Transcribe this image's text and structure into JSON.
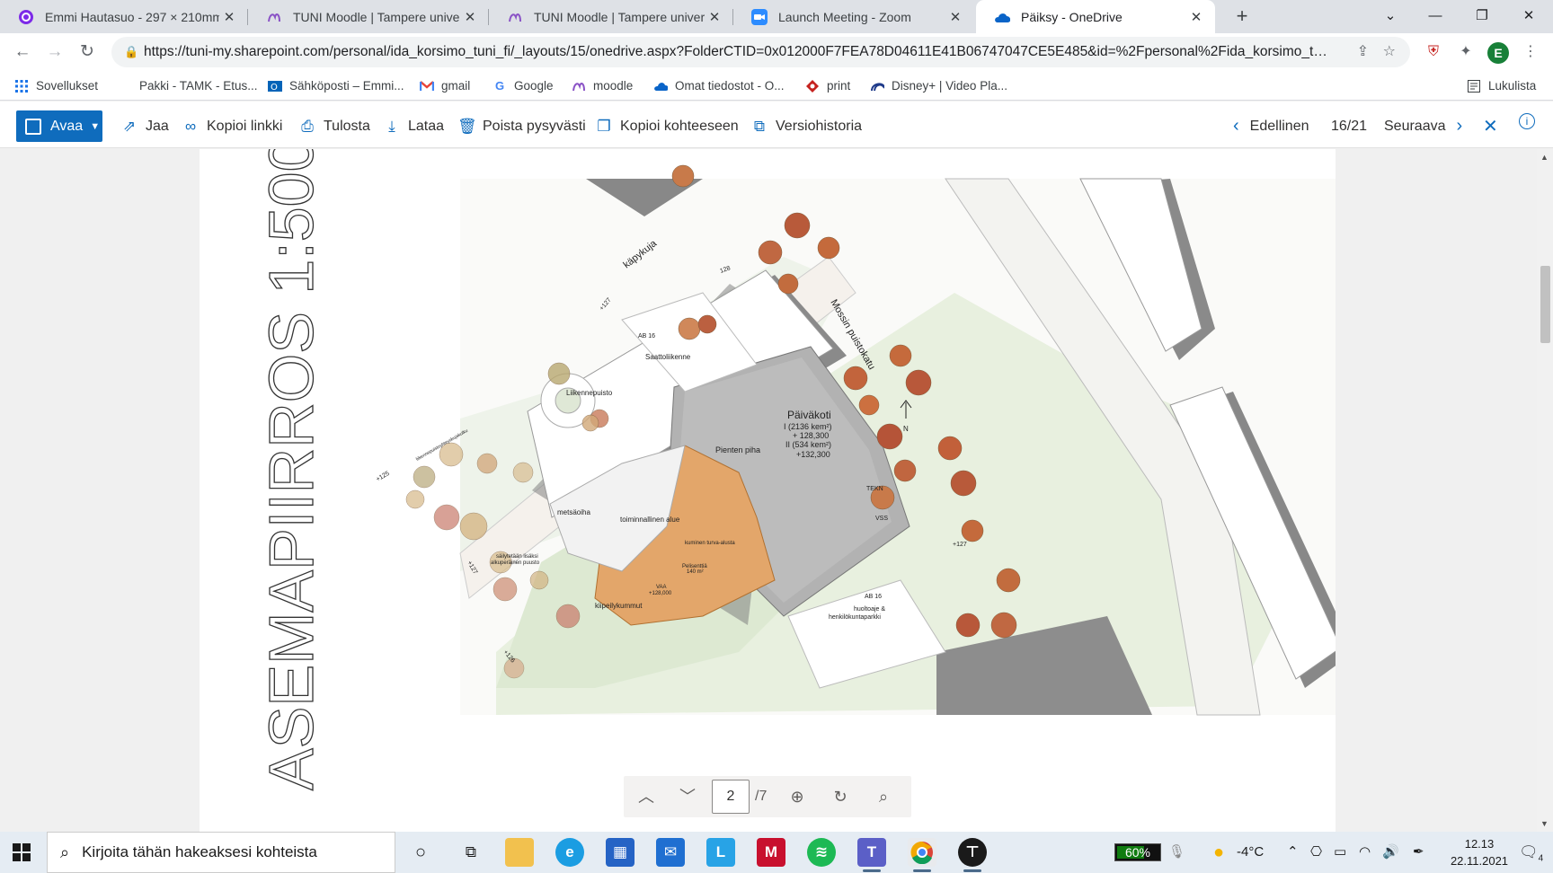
{
  "browser": {
    "tabs": [
      {
        "title": "Emmi Hautasuo - 297 × 210mm",
        "icon": "canva-icon"
      },
      {
        "title": "TUNI Moodle | Tampere universit",
        "icon": "moodle-icon"
      },
      {
        "title": "TUNI Moodle | Tampere universit",
        "icon": "moodle-icon"
      },
      {
        "title": "Launch Meeting - Zoom",
        "icon": "zoom-icon"
      },
      {
        "title": "Päiksy - OneDrive",
        "icon": "onedrive-icon"
      }
    ],
    "url": "https://tuni-my.sharepoint.com/personal/ida_korsimo_tuni_fi/_layouts/15/onedrive.aspx?FolderCTID=0x012000F7FEA78D04611E41B06747047CE5E485&id=%2Fpersonal%2Fida_korsimo_tuni_...",
    "profile_initial": "E",
    "bookmarks": [
      {
        "label": "Sovellukset",
        "icon": "apps-grid-icon"
      },
      {
        "label": "Pakki - TAMK - Etus...",
        "icon": "none"
      },
      {
        "label": "Sähköposti – Emmi...",
        "icon": "outlook-icon"
      },
      {
        "label": "gmail",
        "icon": "gmail-icon"
      },
      {
        "label": "Google",
        "icon": "google-icon"
      },
      {
        "label": "moodle",
        "icon": "moodle-icon"
      },
      {
        "label": "Omat tiedostot - O...",
        "icon": "onedrive-icon"
      },
      {
        "label": "print",
        "icon": "print-icon"
      },
      {
        "label": "Disney+ | Video Pla...",
        "icon": "disney-icon"
      }
    ],
    "reading_list": "Lukulista"
  },
  "commandbar": {
    "open": "Avaa",
    "share": "Jaa",
    "copy_link": "Kopioi linkki",
    "print": "Tulosta",
    "download": "Lataa",
    "delete": "Poista pysyvästi",
    "copy_to": "Kopioi kohteeseen",
    "version_history": "Versiohistoria",
    "previous": "Edellinen",
    "position": "16/21",
    "next": "Seuraava"
  },
  "document": {
    "title": "ASEMAPIIRROS 1:500",
    "plan_labels": {
      "kapykuja": "käpykuja",
      "mossin": "Mossin puistokatu",
      "ab16_top": "AB 16",
      "saatto": "Saattoliikenne",
      "liikennepuisto": "Liikennepuisto",
      "paivakoti": "Päiväkoti",
      "area1": "I (2136 kem²)",
      "h1": "+ 128,300",
      "area2": "II (534 kem²)",
      "h2": "+132,300",
      "pienten": "Pienten piha",
      "metsaoiha": "metsäoiha",
      "toiminnallinen": "toiminnallinen alue",
      "kuminen": "kuminen turva-alusta",
      "pelisenttia": "Pelisenttiä",
      "pelisenttia_area": "140 m²",
      "kiipeily": "kiipeilykummut",
      "vaa": "VAA",
      "vaa_h": "+128,000",
      "sailytetaan": "säilytetään lisäksi",
      "alkuperainen": "alkuperäinen puusto",
      "tekn": "TEKN",
      "vss": "VSS",
      "ab16_bottom": "AB 16",
      "huolto": "huoltoaje &",
      "henkilokunta": "henkilökuntaparkki",
      "path": "liikennepuistoyhteyskujakulku",
      "e125": "+125",
      "e127a": "+127",
      "e127b": "+127",
      "e127c": "+127",
      "e126": "+126",
      "e128": "128",
      "north": "N"
    },
    "page_current": "2",
    "page_total": "/7"
  },
  "taskbar": {
    "search_placeholder": "Kirjoita tähän hakeaksesi kohteista",
    "battery": "60%",
    "temperature": "-4°C",
    "time": "12.13",
    "date": "22.11.2021",
    "notifications": "4"
  },
  "colors": {
    "accent": "#0f6cbd",
    "tab_bg": "#dee1e6",
    "taskbar": "#e5ecf3"
  }
}
